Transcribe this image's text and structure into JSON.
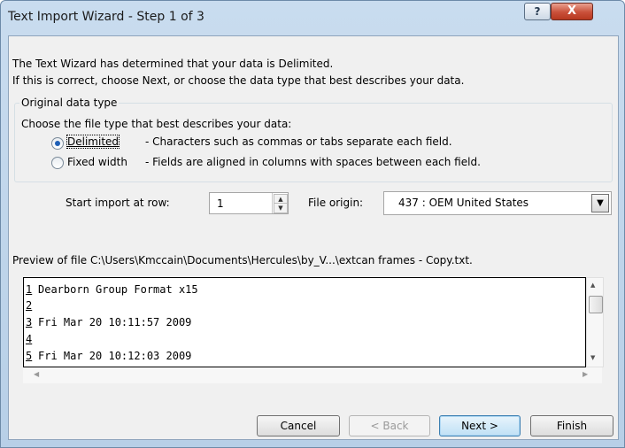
{
  "window": {
    "title": "Text Import Wizard - Step 1 of 3",
    "help_label": "?",
    "close_label": "X"
  },
  "intro": {
    "line1": "The Text Wizard has determined that your data is Delimited.",
    "line2": "If this is correct, choose Next, or choose the data type that best describes your data."
  },
  "data_type": {
    "group_label": "Original data type",
    "prompt": "Choose the file type that best describes your data:",
    "options": [
      {
        "label": "Delimited",
        "description": "- Characters such as commas or tabs separate each field.",
        "selected": true
      },
      {
        "label": "Fixed width",
        "description": "- Fields are aligned in columns with spaces between each field.",
        "selected": false
      }
    ]
  },
  "import": {
    "start_row_label": "Start import at row:",
    "start_row_value": "1",
    "file_origin_label": "File origin:",
    "file_origin_value": "437 : OEM United States"
  },
  "preview": {
    "label": "Preview of file C:\\Users\\Kmccain\\Documents\\Hercules\\by_V...\\extcan frames - Copy.txt.",
    "lines": [
      {
        "num": "1",
        "text": "Dearborn Group Format x15"
      },
      {
        "num": "2",
        "text": ""
      },
      {
        "num": "3",
        "text": "Fri Mar 20 10:11:57 2009"
      },
      {
        "num": "4",
        "text": ""
      },
      {
        "num": "5",
        "text": "Fri Mar 20 10:12:03 2009"
      }
    ]
  },
  "buttons": {
    "cancel": "Cancel",
    "back": "< Back",
    "next": "Next >",
    "finish": "Finish"
  }
}
